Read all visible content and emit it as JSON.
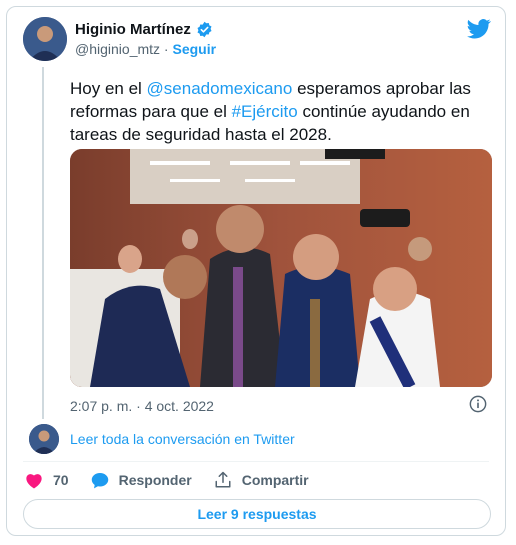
{
  "author": {
    "display_name": "Higinio Martínez",
    "handle": "@higinio_mtz",
    "separator": "·",
    "follow_label": "Seguir"
  },
  "tweet": {
    "text_before_mention": "Hoy en el ",
    "mention": "@senadomexicano",
    "text_after_mention": " esperamos aprobar las reformas para que el ",
    "hashtag": "#Ejército",
    "text_after_hashtag": " continúe ayudando en tareas de seguridad hasta el 2028.",
    "timestamp": "2:07 p. m. · 4 oct. 2022"
  },
  "thread": {
    "read_conversation_label": "Leer toda la conversación en Twitter"
  },
  "actions": {
    "like_count": "70",
    "reply_label": "Responder",
    "share_label": "Compartir"
  },
  "replies_button_label": "Leer 9 respuestas",
  "colors": {
    "accent": "#1d9bf0",
    "like": "#f91880",
    "text": "#0f1419",
    "muted": "#536471"
  },
  "icons": [
    "verified-badge-icon",
    "twitter-bird-icon",
    "info-icon",
    "heart-icon",
    "reply-bubble-icon",
    "share-icon"
  ]
}
